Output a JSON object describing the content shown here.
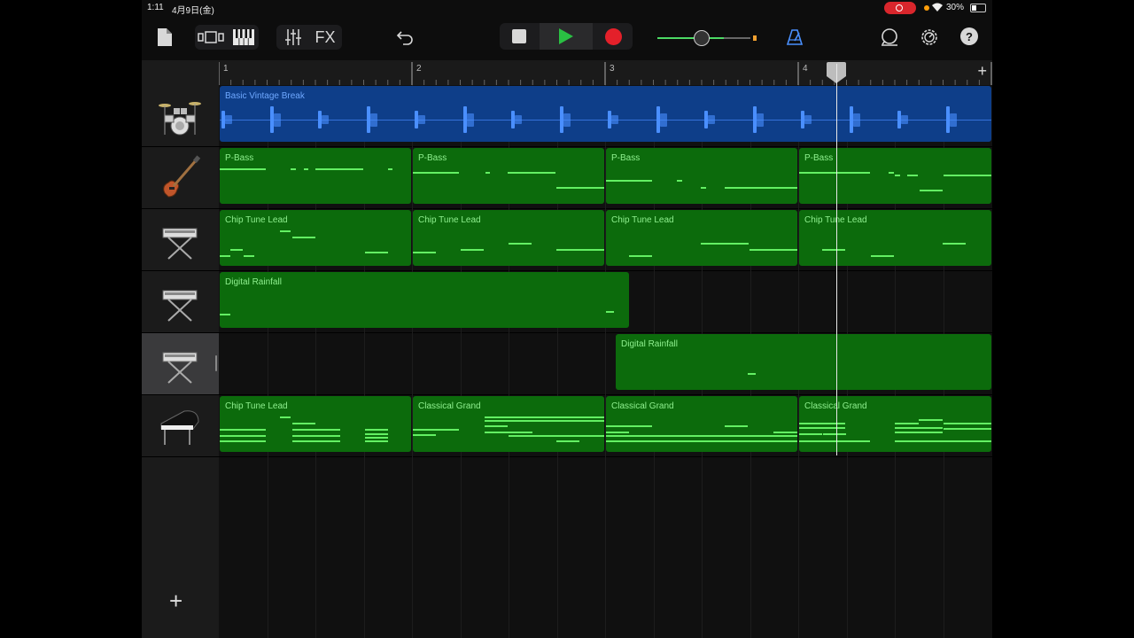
{
  "status": {
    "time": "1:11",
    "date": "4月9日(金)",
    "battery": "30%"
  },
  "toolbar": {
    "fx_label": "FX",
    "help_label": "?",
    "accent_color": "#2ac043",
    "record_color": "#e4202a"
  },
  "ruler": {
    "bars": [
      "1",
      "2",
      "3",
      "4"
    ],
    "add_label": "+"
  },
  "sidebar": {
    "add_label": "+"
  },
  "tracks": [
    {
      "instrument": "drum-kit-icon",
      "regions": [
        {
          "label": "Basic Vintage Break",
          "kind": "audio"
        }
      ]
    },
    {
      "instrument": "bass-guitar-icon",
      "regions": [
        {
          "label": "P-Bass"
        },
        {
          "label": "P-Bass"
        },
        {
          "label": "P-Bass"
        },
        {
          "label": "P-Bass"
        }
      ]
    },
    {
      "instrument": "synth-keyboard-icon",
      "regions": [
        {
          "label": "Chip Tune Lead"
        },
        {
          "label": "Chip Tune Lead"
        },
        {
          "label": "Chip Tune Lead"
        },
        {
          "label": "Chip Tune Lead"
        }
      ]
    },
    {
      "instrument": "synth-keyboard-icon",
      "regions": [
        {
          "label": "Digital Rainfall"
        }
      ]
    },
    {
      "instrument": "synth-keyboard-icon",
      "selected": true,
      "regions": [
        {
          "label": "Digital Rainfall"
        }
      ]
    },
    {
      "instrument": "grand-piano-icon",
      "regions": [
        {
          "label": "Chip Tune Lead"
        },
        {
          "label": "Classical Grand"
        },
        {
          "label": "Classical Grand"
        },
        {
          "label": "Classical Grand"
        }
      ]
    }
  ]
}
